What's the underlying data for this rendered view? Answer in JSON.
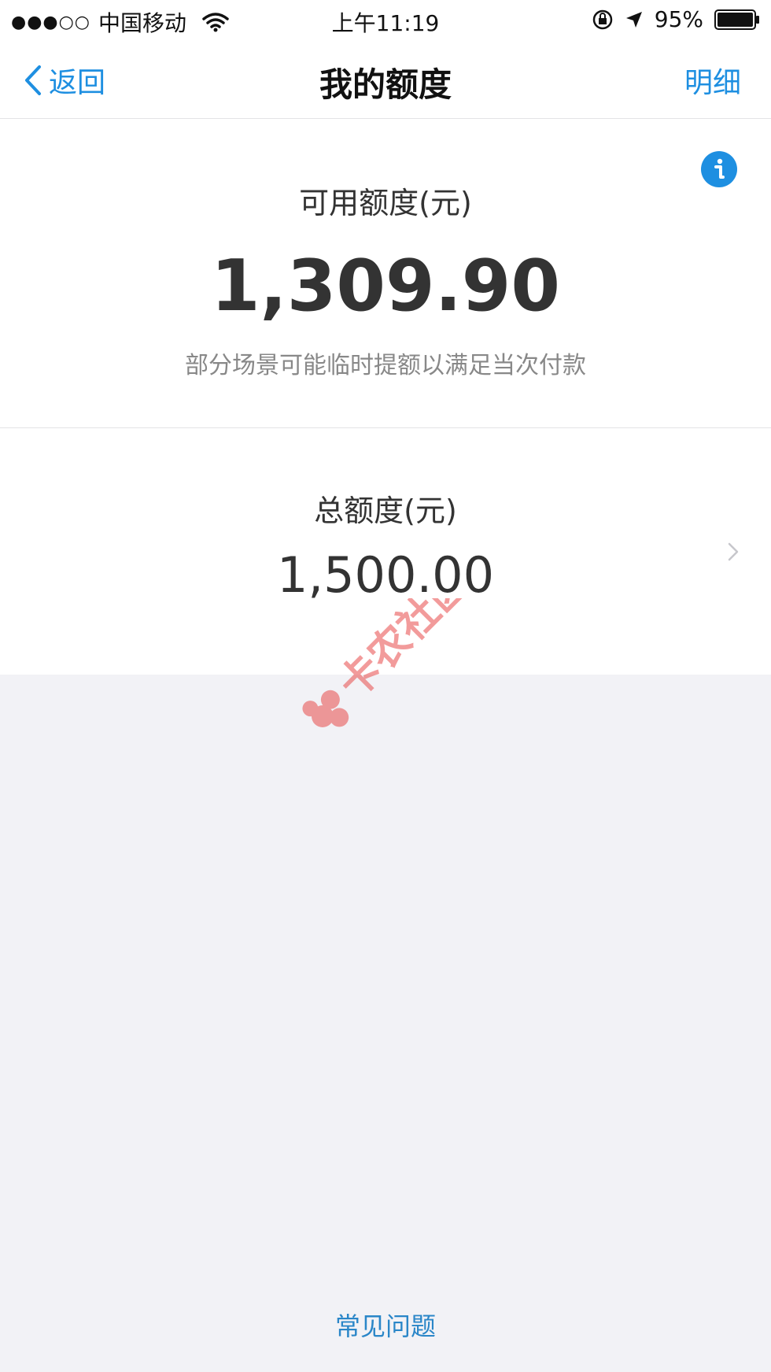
{
  "status_bar": {
    "signal": "●●●○○",
    "carrier": "中国移动",
    "time": "上午11:19",
    "battery": "95%"
  },
  "nav": {
    "back_label": "返回",
    "title": "我的额度",
    "detail_label": "明细"
  },
  "available": {
    "label": "可用额度(元)",
    "amount": "1,309.90",
    "note": "部分场景可能临时提额以满足当次付款"
  },
  "total": {
    "label": "总额度(元)",
    "amount": "1,500.00"
  },
  "faq_label": "常见问题",
  "watermark_text": "卡农社区",
  "icons": {
    "back": "chevron-left-icon",
    "info": "info-icon",
    "arrow": "chevron-right-icon",
    "wifi": "wifi-icon",
    "battery": "battery-icon",
    "lock": "rotation-lock-icon",
    "location": "location-arrow-icon"
  },
  "colors": {
    "accent": "#1e8fe1",
    "background": "#f2f2f6",
    "text": "#333333",
    "muted": "#888888",
    "watermark": "#e84b4b"
  }
}
